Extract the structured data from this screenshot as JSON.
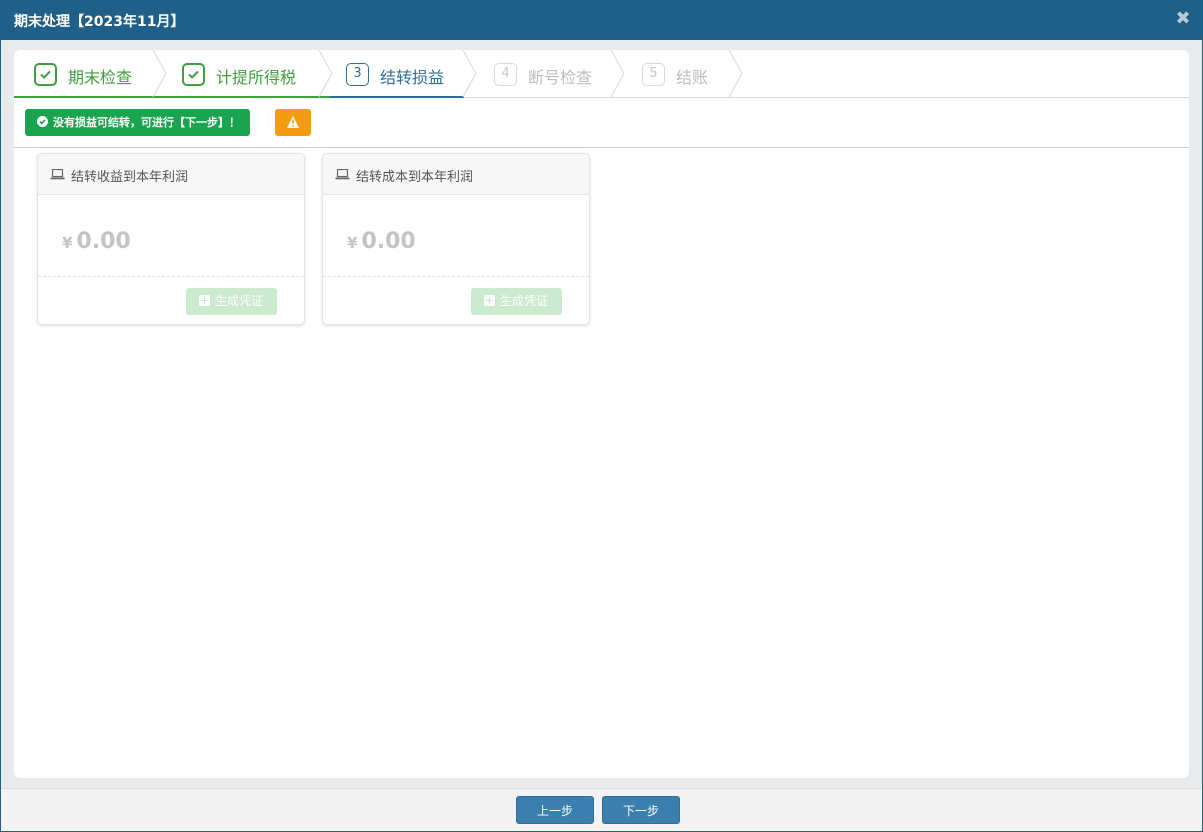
{
  "window": {
    "title": "期末处理【2023年11月】",
    "close_symbol": "✖"
  },
  "steps": [
    {
      "num": "1",
      "label": "期末检查",
      "state": "done"
    },
    {
      "num": "2",
      "label": "计提所得税",
      "state": "done"
    },
    {
      "num": "3",
      "label": "结转损益",
      "state": "active"
    },
    {
      "num": "4",
      "label": "断号检查",
      "state": "todo"
    },
    {
      "num": "5",
      "label": "结账",
      "state": "todo"
    }
  ],
  "notice": {
    "message": "没有损益可结转，可进行【下一步】！"
  },
  "cards": [
    {
      "title": "结转收益到本年利润",
      "currency": "¥",
      "amount": "0.00",
      "button": "生成凭证"
    },
    {
      "title": "结转成本到本年利润",
      "currency": "¥",
      "amount": "0.00",
      "button": "生成凭证"
    }
  ],
  "footer": {
    "prev_label": "上一步",
    "next_label": "下一步"
  },
  "colors": {
    "titlebar": "#1f5f88",
    "done": "#3d9f3d",
    "active": "#2c6d9e",
    "success": "#1aa450",
    "warning": "#f39c12",
    "primary_button": "#3a7fad"
  }
}
